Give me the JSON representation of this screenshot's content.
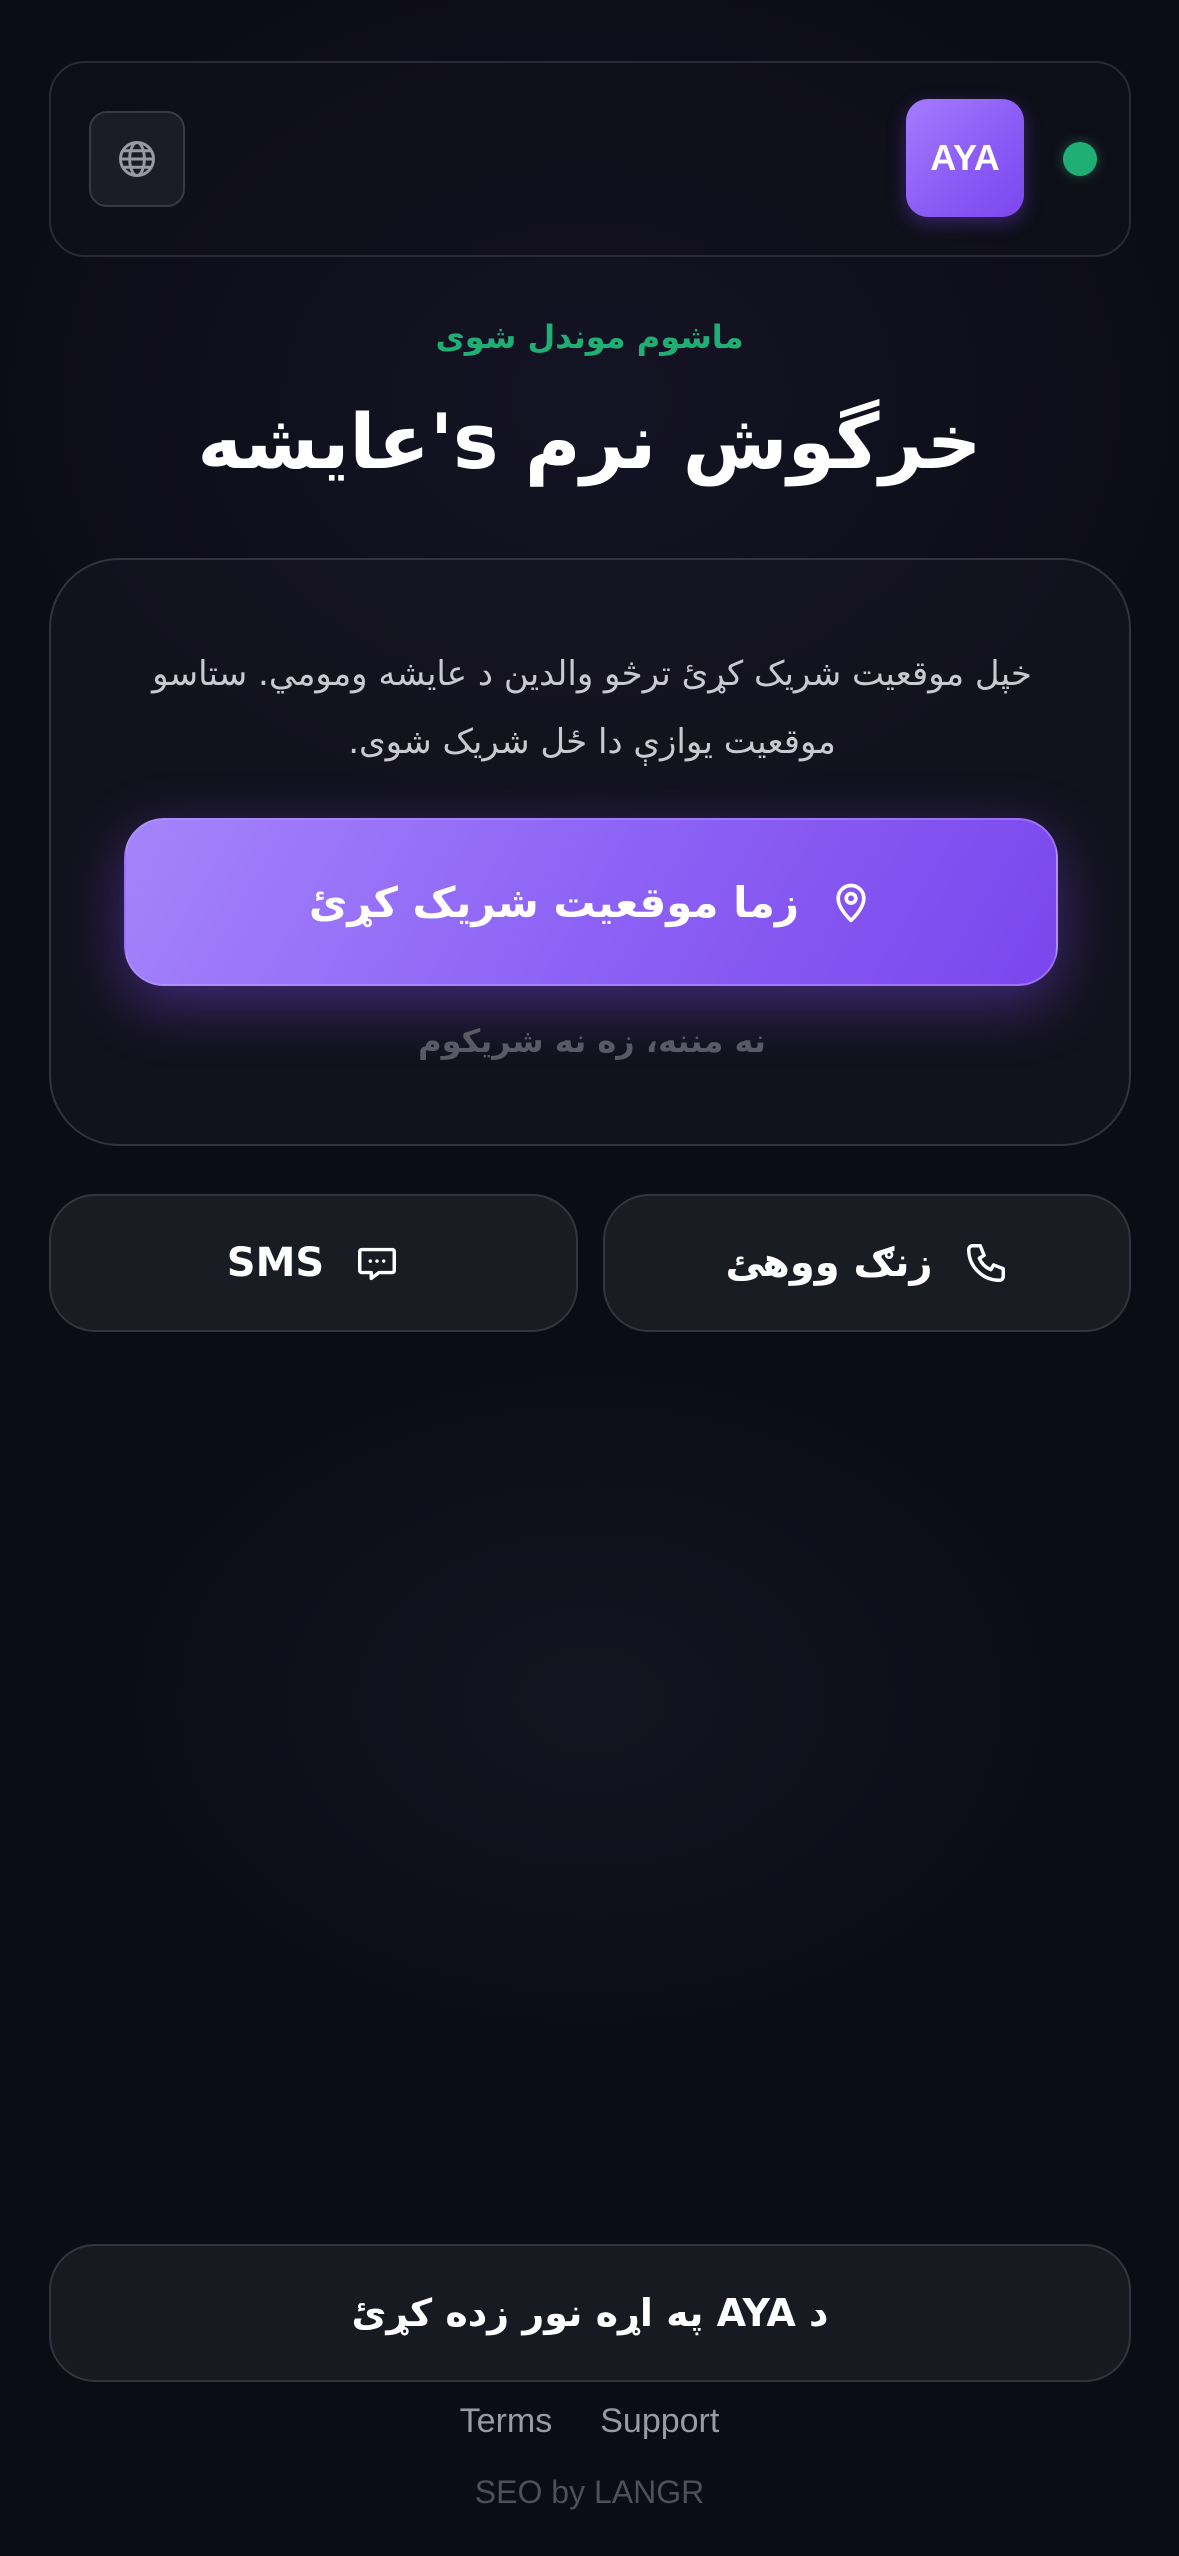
{
  "header": {
    "logo_text": "AYA",
    "globe_icon": "globe-icon",
    "status_color": "#1fae73"
  },
  "hero": {
    "subtitle": "ماشوم موندل شوی",
    "title": "عایشه's خرگوش نرم"
  },
  "share_card": {
    "description": "خپل موقعیت شریک کړئ ترڅو والدین د عایشه ومومي. ستاسو موقعیت یوازې دا ځل شریک شوی.",
    "share_button_label": "زما موقعیت شریک کړئ",
    "share_icon": "map-pin-icon",
    "decline_label": "نه مننه، زه نه شریکوم"
  },
  "actions": {
    "sms_label": "SMS",
    "sms_icon": "message-icon",
    "call_label": "زنګ ووهئ",
    "call_icon": "phone-icon"
  },
  "footer": {
    "promo_label": "د AYA په اړه نور زده کړئ",
    "terms_label": "Terms",
    "support_label": "Support",
    "credit": "SEO by LANGR"
  },
  "colors": {
    "accent": "#8b5cf6",
    "success": "#1fae73",
    "background": "#0c0c16"
  }
}
